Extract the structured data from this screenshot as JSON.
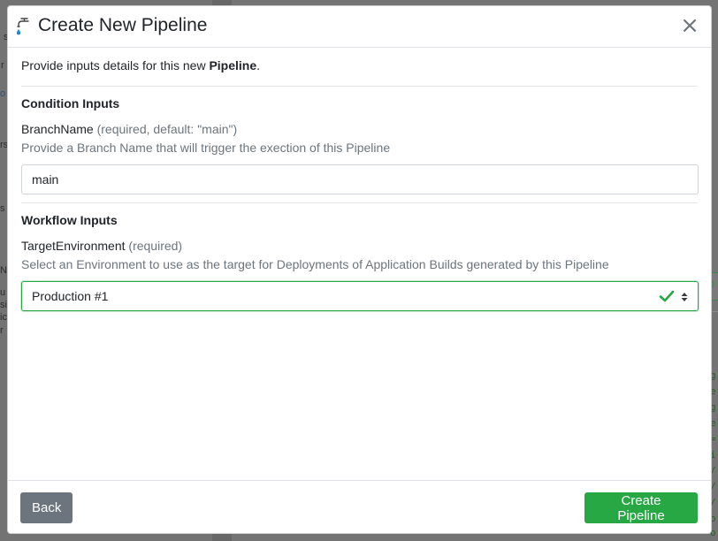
{
  "background": {
    "left_fragments": [
      "s",
      "r",
      "o",
      "rs",
      "s",
      "N",
      "u",
      "sit",
      "ic",
      "r"
    ],
    "right_fragments": [
      "g",
      "e",
      "g",
      "e",
      "=",
      "i",
      "/'",
      "/",
      "/",
      "o",
      "o"
    ]
  },
  "modal": {
    "title": "Create New Pipeline",
    "icon": "faucet-icon",
    "close_label": "×",
    "intro_prefix": "Provide inputs details for this new ",
    "intro_bold": "Pipeline",
    "intro_suffix": ".",
    "condition_inputs": {
      "title": "Condition Inputs",
      "field": {
        "name": "BranchName",
        "meta": "(required, default: \"main\")",
        "help": "Provide a Branch Name that will trigger the exection of this Pipeline",
        "value": "main"
      }
    },
    "workflow_inputs": {
      "title": "Workflow Inputs",
      "field": {
        "name": "TargetEnvironment",
        "meta": "(required)",
        "help": "Select an Environment to use as the target for Deployments of Application Builds generated by this Pipeline",
        "selected": "Production #1"
      }
    },
    "footer": {
      "back_label": "Back",
      "create_label": "Create Pipeline"
    }
  },
  "colors": {
    "primary_green": "#28a745",
    "secondary_gray": "#6c757d",
    "faucet_blue": "#1e88e5"
  }
}
